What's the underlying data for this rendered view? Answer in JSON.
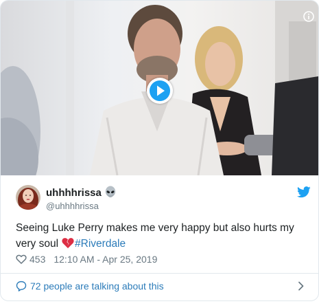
{
  "tweet": {
    "display_name": "uhhhhrissa",
    "name_emoji_icon": "alien-icon",
    "handle": "@uhhhhrissa",
    "text_before": "Seeing Luke Perry makes me very happy but also hurts my very soul",
    "emoji_icon": "broken-heart-icon",
    "hashtag": "#Riverdale",
    "like_count": "453",
    "timestamp": "12:10 AM - Apr 25, 2019",
    "talking_text": "72 people are talking about this"
  },
  "media": {
    "type": "video",
    "play_icon": "play-icon",
    "info_icon": "info-icon"
  },
  "colors": {
    "link": "#2b7bb9",
    "twitter_blue": "#1da1f2",
    "meta_gray": "#697882",
    "border": "#e1e8ed",
    "broken_heart": "#dd2e44"
  }
}
